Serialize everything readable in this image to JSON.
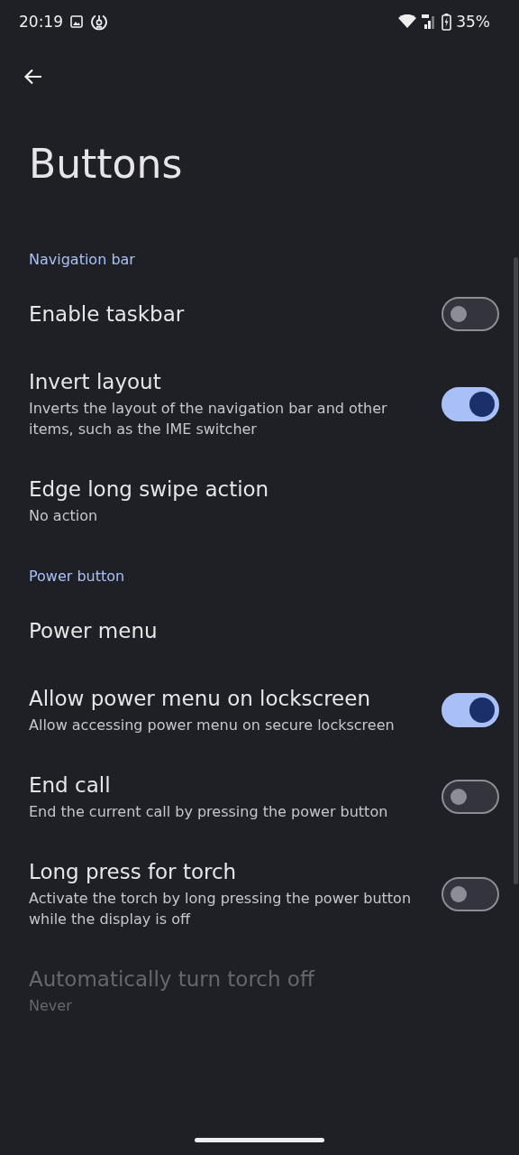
{
  "status_bar": {
    "time": "20:19",
    "battery": "35%"
  },
  "title": "Buttons",
  "sections": [
    {
      "header": "Navigation bar",
      "items": [
        {
          "kind": "switch",
          "title": "Enable taskbar",
          "on": false,
          "disabled": false
        },
        {
          "kind": "switch",
          "title": "Invert layout",
          "summary": "Inverts the layout of the navigation bar and other items, such as the IME switcher",
          "on": true,
          "disabled": false
        },
        {
          "kind": "plain",
          "title": "Edge long swipe action",
          "summary": "No action",
          "disabled": false
        }
      ]
    },
    {
      "header": "Power button",
      "items": [
        {
          "kind": "plain",
          "title": "Power menu",
          "disabled": false
        },
        {
          "kind": "switch",
          "title": "Allow power menu on lockscreen",
          "summary": "Allow accessing power menu on secure lockscreen",
          "on": true,
          "disabled": false
        },
        {
          "kind": "switch",
          "title": "End call",
          "summary": "End the current call by pressing the power button",
          "on": false,
          "disabled": false
        },
        {
          "kind": "switch",
          "title": "Long press for torch",
          "summary": "Activate the torch by long pressing the power button while the display is off",
          "on": false,
          "disabled": false
        },
        {
          "kind": "plain",
          "title": "Automatically turn torch off",
          "summary": "Never",
          "disabled": true
        }
      ]
    }
  ]
}
